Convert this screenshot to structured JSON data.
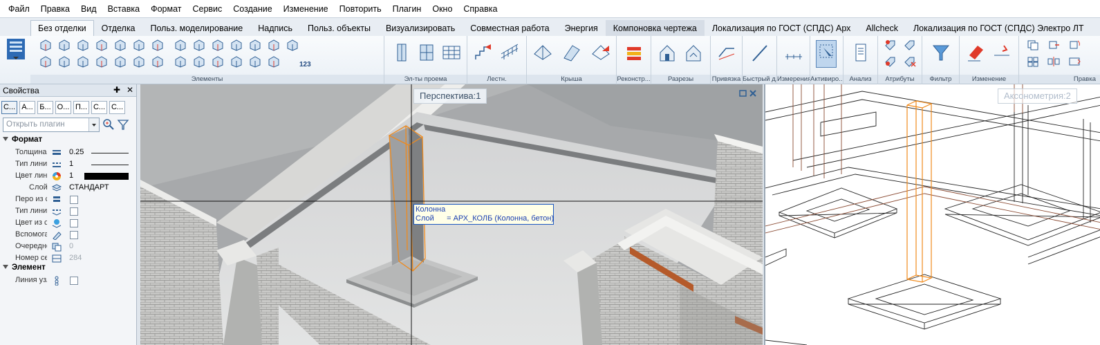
{
  "menu": [
    "Файл",
    "Правка",
    "Вид",
    "Вставка",
    "Формат",
    "Сервис",
    "Создание",
    "Изменение",
    "Повторить",
    "Плагин",
    "Окно",
    "Справка"
  ],
  "tabs": [
    {
      "label": "Без отделки",
      "active": true
    },
    {
      "label": "Отделка"
    },
    {
      "label": "Польз. моделирование"
    },
    {
      "label": "Надпись"
    },
    {
      "label": "Польз. объекты"
    },
    {
      "label": "Визуализировать"
    },
    {
      "label": "Совместная работа"
    },
    {
      "label": "Энергия"
    },
    {
      "label": "Компоновка чертежа",
      "highlighted": true
    },
    {
      "label": "Локализация по ГОСТ (СПДС) Арх"
    },
    {
      "label": "Allcheck"
    },
    {
      "label": "Локализация по ГОСТ (СПДС) Электро ЛТ"
    }
  ],
  "ribbon_groups": [
    "Элементы",
    "Эл-ты проема",
    "Лестн.",
    "Крыша",
    "Реконстр...",
    "Разрезы",
    "Привязка",
    "Быстрый д...",
    "Измерения",
    "Активиро...",
    "Анализ",
    "Атрибуты",
    "Фильтр",
    "Изменение",
    "Правка"
  ],
  "ribbon_small_label": "123",
  "properties": {
    "title": "Свойства",
    "tabs": [
      "С...",
      "А...",
      "Б...",
      "О...",
      "П...",
      "С...",
      "С..."
    ],
    "plugin_placeholder": "Открыть плагин",
    "sections": {
      "format": "Формат",
      "element": "Элемент"
    },
    "rows": {
      "thickness": {
        "label": "Толщина",
        "value": "0.25"
      },
      "line_type": {
        "label": "Тип линии",
        "value": "1"
      },
      "line_color": {
        "label": "Цвет линии",
        "value": "1"
      },
      "layer": {
        "label": "Слой",
        "value": "СТАНДАРТ"
      },
      "pen_from": {
        "label": "Перо из слоя"
      },
      "linetype_from": {
        "label": "Тип линии из слоя"
      },
      "color_from": {
        "label": "Цвет из слоя"
      },
      "aux": {
        "label": "Вспомогательный"
      },
      "order": {
        "label": "Очередность",
        "value": "0"
      },
      "number": {
        "label": "Номер сегмента",
        "value": "284"
      },
      "node_line": {
        "label": "Линия узла"
      }
    }
  },
  "viewports": {
    "perspective": {
      "label": "Перспектива:1"
    },
    "axonometry": {
      "label": "Аксонометрия:2"
    }
  },
  "tooltip": {
    "line1": "Колонна",
    "line2": "Слой      = АРХ_КОЛБ (Колонна, бетон)"
  },
  "colors": {
    "selection": "#f08a1c",
    "tooltip_border": "#1a56c0",
    "tab_active_bg": "#f7f9fb",
    "ribbon_bg": "#eaf0f6"
  }
}
